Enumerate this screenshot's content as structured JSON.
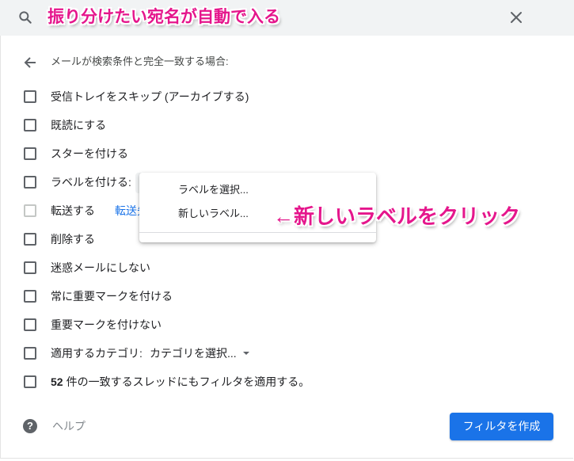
{
  "search": {
    "icon": "search-icon",
    "annotation": "振り分けたい宛名が自動で入る",
    "close_icon": "close-icon"
  },
  "header": {
    "back_icon": "arrow-back-icon",
    "title": "メールが検索条件と完全一致する場合:"
  },
  "actions": [
    {
      "label": "受信トレイをスキップ (アーカイブする)",
      "checked": false
    },
    {
      "label": "既読にする",
      "checked": false
    },
    {
      "label": "スターを付ける",
      "checked": false
    },
    {
      "label": "ラベルを付ける:",
      "checked": false
    },
    {
      "label": "転送する",
      "checked": false,
      "disabled": true,
      "link": "転送先"
    },
    {
      "label": "削除する",
      "checked": false
    },
    {
      "label": "迷惑メールにしない",
      "checked": false
    },
    {
      "label": "常に重要マークを付ける",
      "checked": false
    },
    {
      "label": "重要マークを付けない",
      "checked": false
    },
    {
      "label": "適用するカテゴリ:",
      "checked": false,
      "select": "カテゴリを選択..."
    },
    {
      "count": "52",
      "label": "件の一致するスレッドにもフィルタを適用する。",
      "checked": false
    }
  ],
  "label_menu": {
    "items": [
      "ラベルを選択...",
      "新しいラベル..."
    ]
  },
  "annotation": {
    "click_hint": "←新しいラベルをクリック"
  },
  "footer": {
    "help_icon": "help-icon",
    "help_glyph": "?",
    "help_label": "ヘルプ",
    "create_button": "フィルタを作成"
  },
  "colors": {
    "accent": "#1a73e8",
    "annotation": "#e5168c",
    "search_bg": "#f1f3f4"
  }
}
